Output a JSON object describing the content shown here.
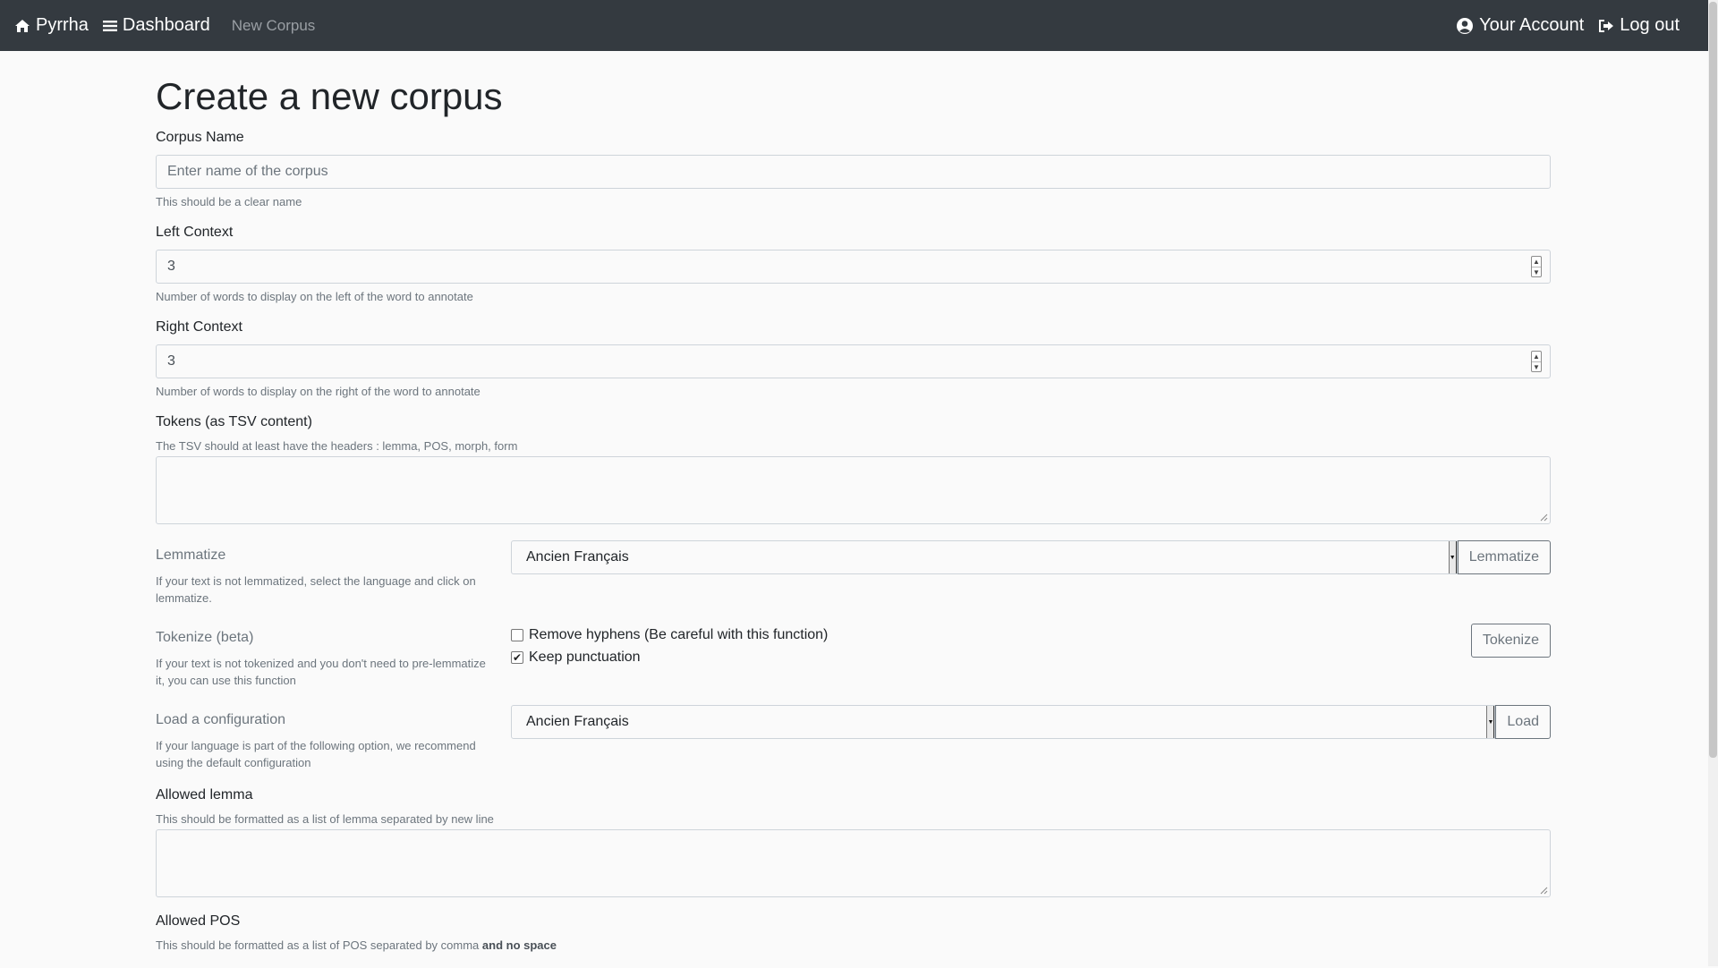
{
  "navbar": {
    "brand": "Pyrrha",
    "dashboard": "Dashboard",
    "breadcrumb": "New Corpus",
    "account": "Your Account",
    "logout": "Log out"
  },
  "page": {
    "title": "Create a new corpus"
  },
  "corpus_name": {
    "label": "Corpus Name",
    "placeholder": "Enter name of the corpus",
    "help": "This should be a clear name"
  },
  "left_context": {
    "label": "Left Context",
    "value": "3",
    "help": "Number of words to display on the left of the word to annotate"
  },
  "right_context": {
    "label": "Right Context",
    "value": "3",
    "help": "Number of words to display on the right of the word to annotate"
  },
  "tokens": {
    "label": "Tokens (as TSV content)",
    "help": "The TSV should at least have the headers : lemma, POS, morph, form"
  },
  "lemmatize": {
    "title": "Lemmatize",
    "help": "If your text is not lemmatized, select the language and click on lemmatize.",
    "selected": "Ancien Français",
    "button": "Lemmatize"
  },
  "tokenize": {
    "title": "Tokenize (beta)",
    "help": "If your text is not tokenized and you don't need to pre-lemmatize it, you can use this function",
    "options": [
      {
        "label": "Remove hyphens (Be careful with this function)",
        "checked": false
      },
      {
        "label": "Keep punctuation",
        "checked": true
      }
    ],
    "button": "Tokenize"
  },
  "load_config": {
    "title": "Load a configuration",
    "help": "If your language is part of the following option, we recommend using the default configuration",
    "selected": "Ancien Français",
    "button": "Load"
  },
  "allowed_lemma": {
    "label": "Allowed lemma",
    "help": "This should be formatted as a list of lemma separated by new line"
  },
  "allowed_pos": {
    "label": "Allowed POS",
    "help_prefix": "This should be formatted as a list of POS separated by comma ",
    "help_bold": "and no space"
  }
}
